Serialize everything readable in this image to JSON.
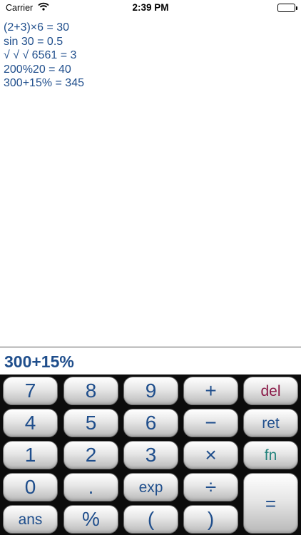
{
  "status_bar": {
    "carrier": "Carrier",
    "time": "2:39 PM"
  },
  "history": [
    "(2+3)×6 = 30",
    "sin 30 = 0.5",
    "√ √ √ 6561 = 3",
    "200%20 = 40",
    "300+15% = 345"
  ],
  "display": {
    "value": "300+15%"
  },
  "keys": {
    "seven": "7",
    "eight": "8",
    "nine": "9",
    "plus": "+",
    "del": "del",
    "four": "4",
    "five": "5",
    "six": "6",
    "minus": "−",
    "ret": "ret",
    "one": "1",
    "two": "2",
    "three": "3",
    "times": "×",
    "fn": "fn",
    "zero": "0",
    "dot": ".",
    "exp": "exp",
    "divide": "÷",
    "equals": "=",
    "ans": "ans",
    "percent": "%",
    "lparen": "(",
    "rparen": ")"
  },
  "colors": {
    "text_blue": "#1f4e8c",
    "del_color": "#8a1a48",
    "fn_color": "#23837d",
    "keypad_bg": "#0c0c0c"
  }
}
